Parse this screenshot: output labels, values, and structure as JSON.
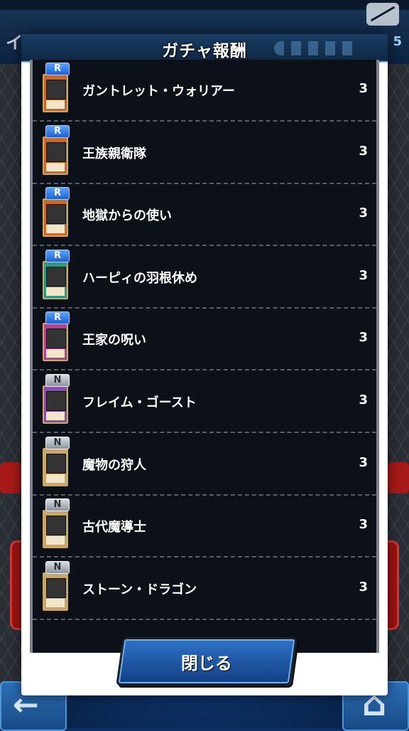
{
  "background": {
    "title": "イベントガチャ",
    "count": "5"
  },
  "dialog": {
    "title": "ガチャ報酬",
    "close_label": "閉じる"
  },
  "rewards": [
    {
      "rarity": "R",
      "name": "ガントレット・ウォリアー",
      "quantity": "3",
      "card_color": "#c96a2a"
    },
    {
      "rarity": "R",
      "name": "王族親衛隊",
      "quantity": "3",
      "card_color": "#c96a2a"
    },
    {
      "rarity": "R",
      "name": "地獄からの使い",
      "quantity": "3",
      "card_color": "#c96a2a"
    },
    {
      "rarity": "R",
      "name": "ハーピィの羽根休め",
      "quantity": "3",
      "card_color": "#2e9a86"
    },
    {
      "rarity": "R",
      "name": "王家の呪い",
      "quantity": "3",
      "card_color": "#b0458f"
    },
    {
      "rarity": "N",
      "name": "フレイム・ゴースト",
      "quantity": "3",
      "card_color": "#8a4fa8"
    },
    {
      "rarity": "N",
      "name": "魔物の狩人",
      "quantity": "3",
      "card_color": "#c9a66b"
    },
    {
      "rarity": "N",
      "name": "古代魔導士",
      "quantity": "3",
      "card_color": "#c9a66b"
    },
    {
      "rarity": "N",
      "name": "ストーン・ドラゴン",
      "quantity": "3",
      "card_color": "#c9a66b"
    }
  ],
  "icons": {
    "back": "back-arrow-icon",
    "home": "home-icon",
    "visibility": "eye-off-icon"
  }
}
